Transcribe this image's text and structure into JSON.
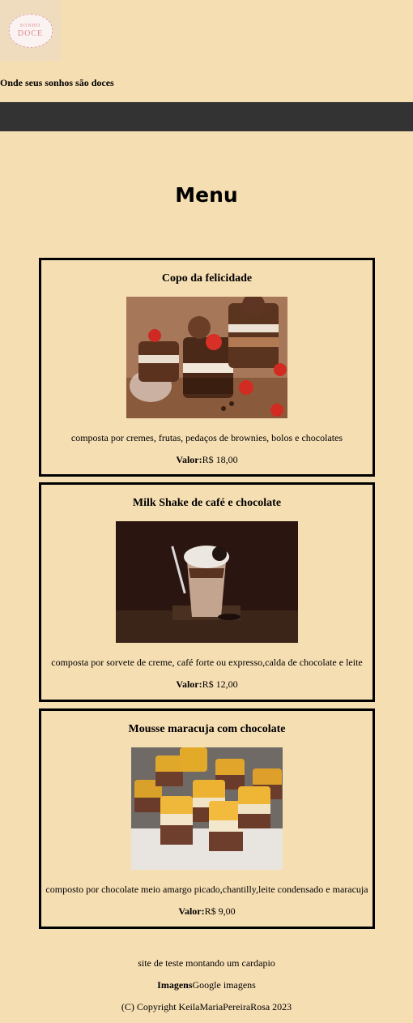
{
  "header": {
    "logo": {
      "small_text": "SONHO",
      "big_text": "DOCE"
    },
    "slogan": "Onde seus sonhos são doces"
  },
  "main": {
    "title": "Menu",
    "items": [
      {
        "name": "Copo da felicidade",
        "description": "composta por cremes, frutas, pedaços de brownies, bolos e chocolates",
        "price_label": "Valor:",
        "price": "R$ 18,00"
      },
      {
        "name": "Milk Shake de café e chocolate",
        "description": "composta por sorvete de creme, café forte ou expresso,calda de chocolate e leite",
        "price_label": "Valor:",
        "price": "R$ 12,00"
      },
      {
        "name": "Mousse maracuja com chocolate",
        "description": "composto por chocolate meio amargo picado,chantilly,leite condensado e maracuja",
        "price_label": "Valor:",
        "price": "R$ 9,00"
      }
    ]
  },
  "footer": {
    "note": "site de teste montando um cardapio",
    "images_label": "Imagens",
    "images_source": "Google imagens",
    "copyright": "(C) Copyright KeilaMariaPereiraRosa 2023"
  }
}
